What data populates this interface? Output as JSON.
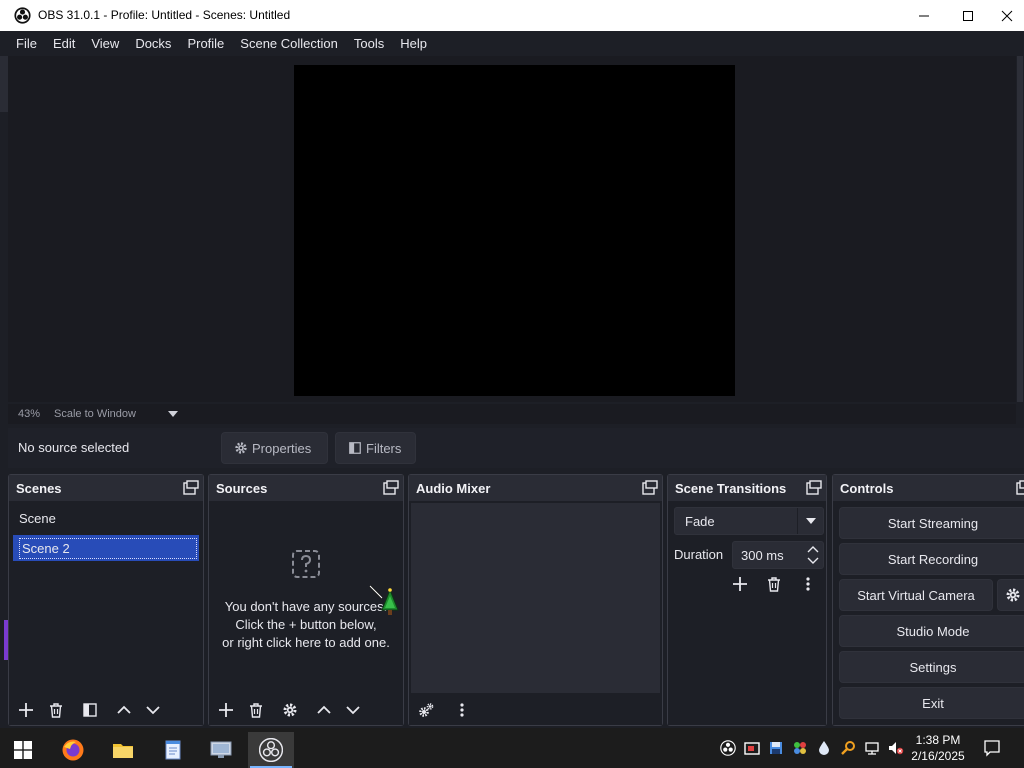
{
  "window": {
    "title": "OBS 31.0.1 - Profile: Untitled - Scenes: Untitled"
  },
  "menu": [
    "File",
    "Edit",
    "View",
    "Docks",
    "Profile",
    "Scene Collection",
    "Tools",
    "Help"
  ],
  "preview": {
    "zoom": "43%",
    "scale_mode": "Scale to Window"
  },
  "context": {
    "selection": "No source selected",
    "properties": "Properties",
    "filters": "Filters"
  },
  "scenes": {
    "title": "Scenes",
    "items": [
      "Scene",
      "Scene 2"
    ],
    "selected_index": 1
  },
  "sources": {
    "title": "Sources",
    "empty_line1": "You don't have any sources.",
    "empty_line2": "Click the + button below,",
    "empty_line3": "or right click here to add one."
  },
  "mixer": {
    "title": "Audio Mixer"
  },
  "transitions": {
    "title": "Scene Transitions",
    "selected": "Fade",
    "duration_label": "Duration",
    "duration_value": "300 ms"
  },
  "controls": {
    "title": "Controls",
    "start_streaming": "Start Streaming",
    "start_recording": "Start Recording",
    "start_virtual_camera": "Start Virtual Camera",
    "studio_mode": "Studio Mode",
    "settings": "Settings",
    "exit": "Exit"
  },
  "taskbar": {
    "time": "1:38 PM",
    "date": "2/16/2025"
  },
  "colors": {
    "accent": "#284cb8",
    "background": "#1d1f26",
    "panel": "#2a2c35"
  }
}
